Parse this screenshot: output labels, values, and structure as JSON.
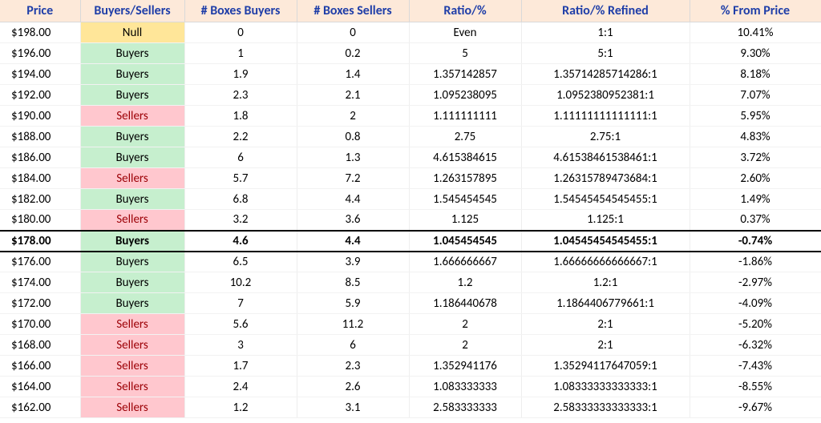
{
  "columns": [
    "Price",
    "Buyers/Sellers",
    "# Boxes Buyers",
    "# Boxes Sellers",
    "Ratio/%",
    "Ratio/% Refined",
    "% From Price"
  ],
  "rows": [
    {
      "price": "$198.00",
      "side": "Null",
      "boxes_buyers": "0",
      "boxes_sellers": "0",
      "ratio": "Even",
      "ratio_refined": "1:1",
      "from_price": "10.41%",
      "highlight": false
    },
    {
      "price": "$196.00",
      "side": "Buyers",
      "boxes_buyers": "1",
      "boxes_sellers": "0.2",
      "ratio": "5",
      "ratio_refined": "5:1",
      "from_price": "9.30%",
      "highlight": false
    },
    {
      "price": "$194.00",
      "side": "Buyers",
      "boxes_buyers": "1.9",
      "boxes_sellers": "1.4",
      "ratio": "1.357142857",
      "ratio_refined": "1.35714285714286:1",
      "from_price": "8.18%",
      "highlight": false
    },
    {
      "price": "$192.00",
      "side": "Buyers",
      "boxes_buyers": "2.3",
      "boxes_sellers": "2.1",
      "ratio": "1.095238095",
      "ratio_refined": "1.0952380952381:1",
      "from_price": "7.07%",
      "highlight": false
    },
    {
      "price": "$190.00",
      "side": "Sellers",
      "boxes_buyers": "1.8",
      "boxes_sellers": "2",
      "ratio": "1.111111111",
      "ratio_refined": "1.11111111111111:1",
      "from_price": "5.95%",
      "highlight": false
    },
    {
      "price": "$188.00",
      "side": "Buyers",
      "boxes_buyers": "2.2",
      "boxes_sellers": "0.8",
      "ratio": "2.75",
      "ratio_refined": "2.75:1",
      "from_price": "4.83%",
      "highlight": false
    },
    {
      "price": "$186.00",
      "side": "Buyers",
      "boxes_buyers": "6",
      "boxes_sellers": "1.3",
      "ratio": "4.615384615",
      "ratio_refined": "4.61538461538461:1",
      "from_price": "3.72%",
      "highlight": false
    },
    {
      "price": "$184.00",
      "side": "Sellers",
      "boxes_buyers": "5.7",
      "boxes_sellers": "7.2",
      "ratio": "1.263157895",
      "ratio_refined": "1.26315789473684:1",
      "from_price": "2.60%",
      "highlight": false
    },
    {
      "price": "$182.00",
      "side": "Buyers",
      "boxes_buyers": "6.8",
      "boxes_sellers": "4.4",
      "ratio": "1.545454545",
      "ratio_refined": "1.54545454545455:1",
      "from_price": "1.49%",
      "highlight": false
    },
    {
      "price": "$180.00",
      "side": "Sellers",
      "boxes_buyers": "3.2",
      "boxes_sellers": "3.6",
      "ratio": "1.125",
      "ratio_refined": "1.125:1",
      "from_price": "0.37%",
      "highlight": false
    },
    {
      "price": "$178.00",
      "side": "Buyers",
      "boxes_buyers": "4.6",
      "boxes_sellers": "4.4",
      "ratio": "1.045454545",
      "ratio_refined": "1.04545454545455:1",
      "from_price": "-0.74%",
      "highlight": true
    },
    {
      "price": "$176.00",
      "side": "Buyers",
      "boxes_buyers": "6.5",
      "boxes_sellers": "3.9",
      "ratio": "1.666666667",
      "ratio_refined": "1.66666666666667:1",
      "from_price": "-1.86%",
      "highlight": false
    },
    {
      "price": "$174.00",
      "side": "Buyers",
      "boxes_buyers": "10.2",
      "boxes_sellers": "8.5",
      "ratio": "1.2",
      "ratio_refined": "1.2:1",
      "from_price": "-2.97%",
      "highlight": false
    },
    {
      "price": "$172.00",
      "side": "Buyers",
      "boxes_buyers": "7",
      "boxes_sellers": "5.9",
      "ratio": "1.186440678",
      "ratio_refined": "1.1864406779661:1",
      "from_price": "-4.09%",
      "highlight": false
    },
    {
      "price": "$170.00",
      "side": "Sellers",
      "boxes_buyers": "5.6",
      "boxes_sellers": "11.2",
      "ratio": "2",
      "ratio_refined": "2:1",
      "from_price": "-5.20%",
      "highlight": false
    },
    {
      "price": "$168.00",
      "side": "Sellers",
      "boxes_buyers": "3",
      "boxes_sellers": "6",
      "ratio": "2",
      "ratio_refined": "2:1",
      "from_price": "-6.32%",
      "highlight": false
    },
    {
      "price": "$166.00",
      "side": "Sellers",
      "boxes_buyers": "1.7",
      "boxes_sellers": "2.3",
      "ratio": "1.352941176",
      "ratio_refined": "1.35294117647059:1",
      "from_price": "-7.43%",
      "highlight": false
    },
    {
      "price": "$164.00",
      "side": "Sellers",
      "boxes_buyers": "2.4",
      "boxes_sellers": "2.6",
      "ratio": "1.083333333",
      "ratio_refined": "1.08333333333333:1",
      "from_price": "-8.55%",
      "highlight": false
    },
    {
      "price": "$162.00",
      "side": "Sellers",
      "boxes_buyers": "1.2",
      "boxes_sellers": "3.1",
      "ratio": "2.583333333",
      "ratio_refined": "2.58333333333333:1",
      "from_price": "-9.67%",
      "highlight": false
    }
  ]
}
